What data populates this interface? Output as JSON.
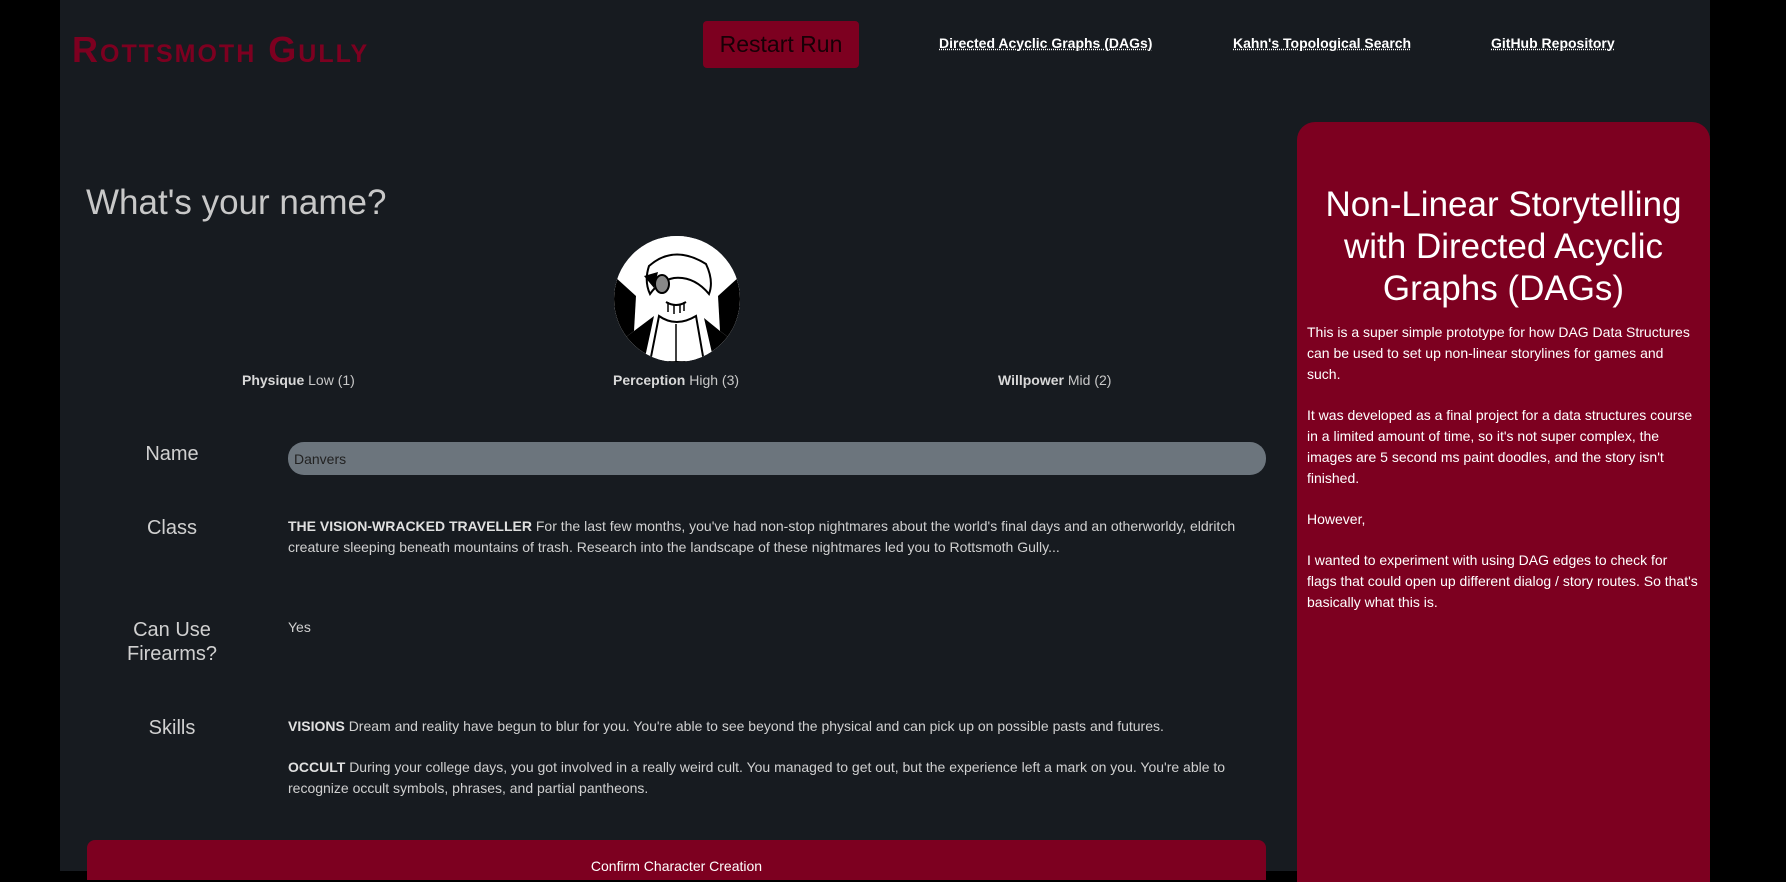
{
  "header": {
    "logo": "Rottsmoth Gully",
    "restart_label": "Restart Run",
    "links": [
      "Directed Acyclic Graphs (DAGs)",
      "Kahn's Topological Search",
      "GitHub Repository"
    ]
  },
  "main": {
    "prompt": "What's your name?",
    "stats": [
      {
        "name": "Physique",
        "value": "Low (1)"
      },
      {
        "name": "Perception",
        "value": "High (3)"
      },
      {
        "name": "Willpower",
        "value": "Mid (2)"
      }
    ],
    "name_label": "Name",
    "name_value": "Danvers",
    "class_label": "Class",
    "class_title": "THE VISION-WRACKED TRAVELLER",
    "class_desc": "For the last few months, you've had non-stop nightmares about the world's final days and an otherworldy, eldritch creature sleeping beneath mountains of trash. Research into the landscape of these nightmares led you to Rottsmoth Gully...",
    "firearms_label": "Can Use Firearms?",
    "firearms_value": "Yes",
    "skills_label": "Skills",
    "skills": [
      {
        "name": "VISIONS",
        "desc": "Dream and reality have begun to blur for you. You're able to see beyond the physical and can pick up on possible pasts and futures."
      },
      {
        "name": "OCCULT",
        "desc": "During your college days, you got involved in a really weird cult. You managed to get out, but the experience left a mark on you. You're able to recognize occult symbols, phrases, and partial pantheons."
      }
    ],
    "confirm_label": "Confirm Character Creation"
  },
  "sidebar": {
    "title": "Non-Linear Storytelling with Directed Acyclic Graphs (DAGs)",
    "paragraphs": [
      "This is a super simple prototype for how DAG Data Structures can be used to set up non-linear storylines for games and such.",
      "It was developed as a final project for a data structures course in a limited amount of time, so it's not super complex, the images are 5 second ms paint doodles, and the story isn't finished.",
      "However,",
      "I wanted to experiment with using DAG edges to check for flags that could open up different dialog / story routes. So that's basically what this is."
    ]
  },
  "colors": {
    "accent": "#7d0020",
    "background": "#171b20",
    "input": "#6c757d"
  },
  "icons": {
    "portrait": "character-portrait-doodle"
  }
}
